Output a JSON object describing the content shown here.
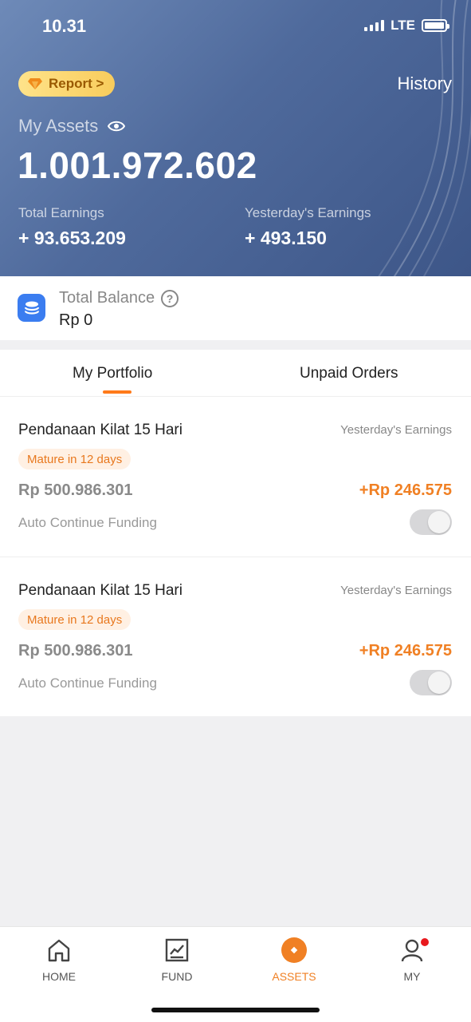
{
  "status_bar": {
    "time": "10.31",
    "network": "LTE"
  },
  "header": {
    "report_label": "Report >",
    "history_label": "History",
    "assets_label": "My Assets",
    "assets_value": "1.001.972.602",
    "total_earnings_label": "Total Earnings",
    "total_earnings_value": "+ 93.653.209",
    "yesterday_earnings_label": "Yesterday's Earnings",
    "yesterday_earnings_value": "+ 493.150"
  },
  "balance": {
    "label": "Total Balance",
    "value": "Rp 0"
  },
  "tabs": [
    {
      "label": "My Portfolio",
      "active": true
    },
    {
      "label": "Unpaid Orders",
      "active": false
    }
  ],
  "portfolio": [
    {
      "title": "Pendanaan Kilat 15 Hari",
      "yesterday_label": "Yesterday's Earnings",
      "badge": "Mature in 12 days",
      "amount": "Rp 500.986.301",
      "earnings": "+Rp 246.575",
      "auto_label": "Auto Continue Funding",
      "auto_enabled": false
    },
    {
      "title": "Pendanaan Kilat 15 Hari",
      "yesterday_label": "Yesterday's Earnings",
      "badge": "Mature in 12 days",
      "amount": "Rp 500.986.301",
      "earnings": "+Rp 246.575",
      "auto_label": "Auto Continue Funding",
      "auto_enabled": false
    }
  ],
  "bottom_nav": [
    {
      "label": "HOME",
      "icon": "home-icon",
      "active": false
    },
    {
      "label": "FUND",
      "icon": "chart-icon",
      "active": false
    },
    {
      "label": "ASSETS",
      "icon": "assets-icon",
      "active": true
    },
    {
      "label": "MY",
      "icon": "user-icon",
      "active": false,
      "notification": true
    }
  ],
  "colors": {
    "accent": "#f08024",
    "hero": "#4f6a9c",
    "balance_icon": "#3b7df0"
  }
}
